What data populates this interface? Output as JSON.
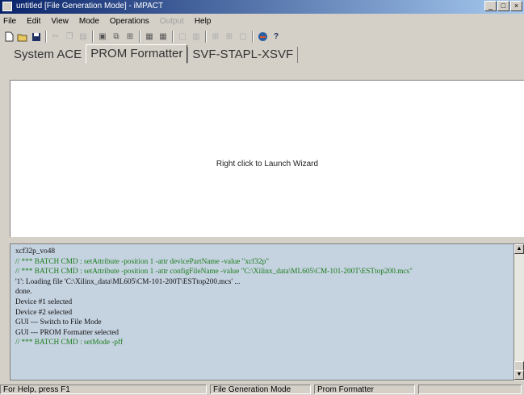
{
  "window": {
    "title": "untitled [File Generation Mode] - iMPACT",
    "controls": [
      "_",
      "□",
      "×"
    ]
  },
  "menu": [
    {
      "label": "File",
      "enabled": true
    },
    {
      "label": "Edit",
      "enabled": true
    },
    {
      "label": "View",
      "enabled": true
    },
    {
      "label": "Mode",
      "enabled": true
    },
    {
      "label": "Operations",
      "enabled": true
    },
    {
      "label": "Output",
      "enabled": false
    },
    {
      "label": "Help",
      "enabled": true
    }
  ],
  "toolbar": {
    "icons": [
      "new-icon",
      "open-icon",
      "save-icon",
      "sep",
      "cut-icon",
      "copy-icon",
      "paste-icon",
      "sep",
      "device-icon",
      "chain-icon",
      "chain-icon-2",
      "sep",
      "grid-icon",
      "grid-icon-2",
      "sep",
      "window-icon",
      "window-icon-2",
      "sep",
      "grid-icon-3",
      "grid-icon-4",
      "window-icon-3",
      "sep",
      "impact-icon",
      "help-icon"
    ]
  },
  "tabs": [
    {
      "label": "System ACE",
      "active": false
    },
    {
      "label": "PROM Formatter",
      "active": true
    },
    {
      "label": "SVF-STAPL-XSVF",
      "active": false
    }
  ],
  "canvas": {
    "hint": "Right click to Launch Wizard"
  },
  "console": {
    "lines": [
      {
        "text": "xcf32p_vo48",
        "batch": false
      },
      {
        "text": "// *** BATCH CMD : setAttribute -position 1 -attr devicePartName -value \"xcf32p\"",
        "batch": true
      },
      {
        "text": "// *** BATCH CMD : setAttribute -position 1 -attr configFileName -value \"C:\\Xilinx_data\\ML605\\CM-101-200T\\ESTtop200.mcs\"",
        "batch": true
      },
      {
        "text": "'1': Loading file 'C:\\Xilinx_data\\ML605\\CM-101-200T\\ESTtop200.mcs' ...",
        "batch": false
      },
      {
        "text": "done.",
        "batch": false
      },
      {
        "text": "Device #1 selected",
        "batch": false
      },
      {
        "text": "Device #2 selected",
        "batch": false
      },
      {
        "text": "GUI --- Switch to File Mode",
        "batch": false
      },
      {
        "text": "GUI --- PROM Formatter selected",
        "batch": false
      },
      {
        "text": "// *** BATCH CMD : setMode -pff",
        "batch": true
      }
    ]
  },
  "status": {
    "help": "For Help, press F1",
    "mode": "File Generation Mode",
    "tool": "Prom Formatter"
  }
}
